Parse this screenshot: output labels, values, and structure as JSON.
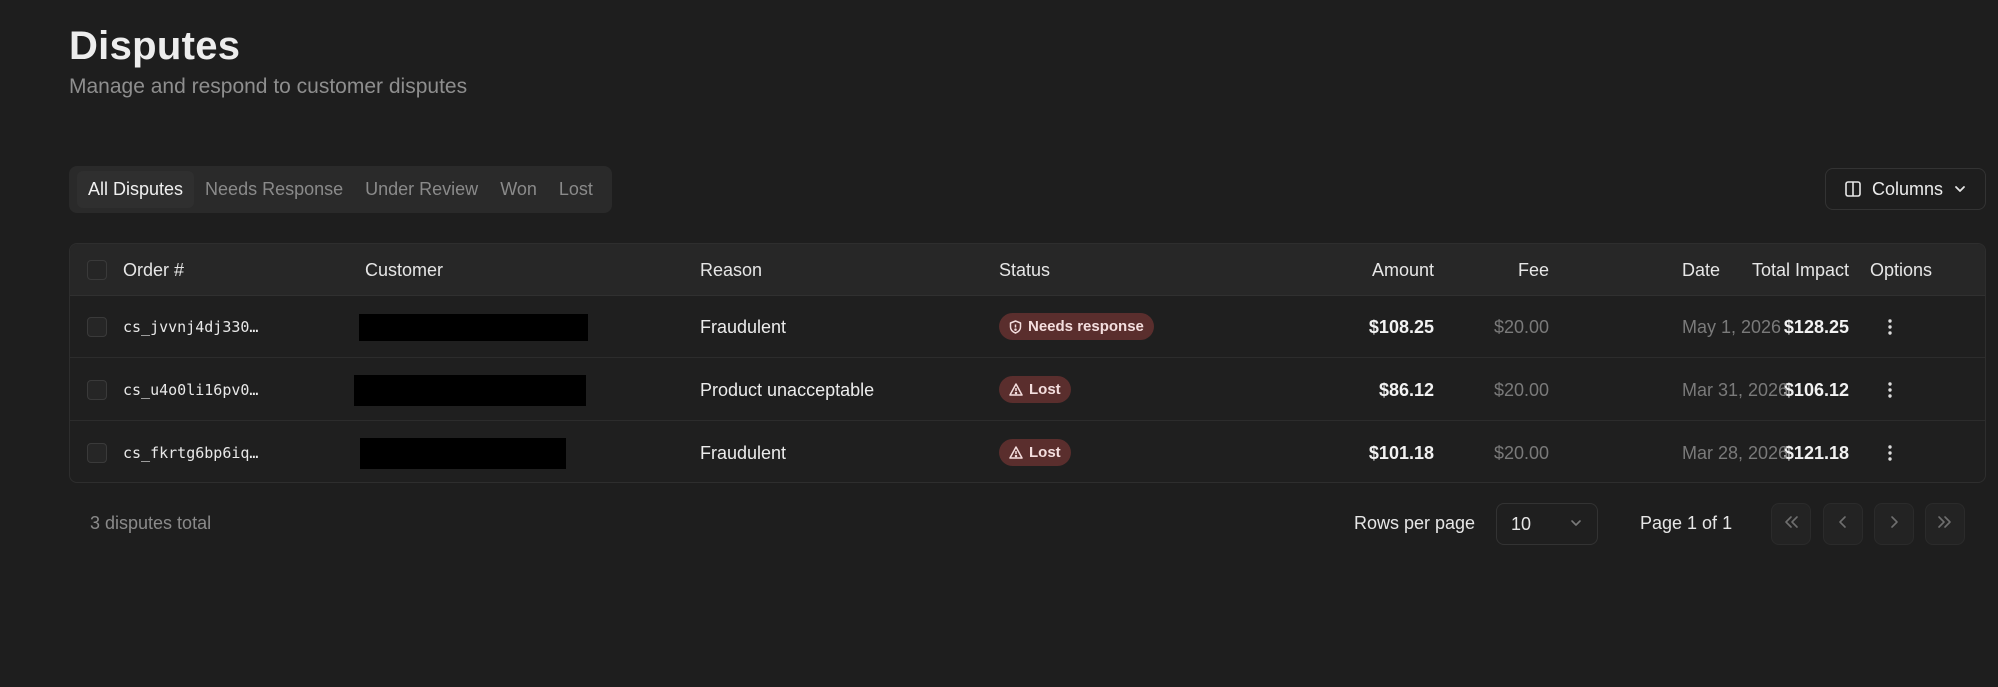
{
  "header": {
    "title": "Disputes",
    "subtitle": "Manage and respond to customer disputes"
  },
  "tabs": [
    {
      "label": "All Disputes",
      "active": true
    },
    {
      "label": "Needs Response",
      "active": false
    },
    {
      "label": "Under Review",
      "active": false
    },
    {
      "label": "Won",
      "active": false
    },
    {
      "label": "Lost",
      "active": false
    }
  ],
  "columns_button": {
    "label": "Columns",
    "icon": "columns-icon",
    "chevron": "chevron-down-icon"
  },
  "table": {
    "headers": {
      "order": "Order #",
      "customer": "Customer",
      "reason": "Reason",
      "status": "Status",
      "amount": "Amount",
      "fee": "Fee",
      "total_impact": "Total Impact",
      "date": "Date",
      "options": "Options"
    },
    "rows": [
      {
        "order": "cs_jvvnj4dj330…",
        "customer": "",
        "reason": "Fraudulent",
        "status": "Needs response",
        "status_icon": "shield-icon",
        "amount": "$108.25",
        "fee": "$20.00",
        "total_impact": "$128.25",
        "date": "May 1, 2026"
      },
      {
        "order": "cs_u4o0li16pv0…",
        "customer": "",
        "reason": "Product unacceptable",
        "status": "Lost",
        "status_icon": "warning-icon",
        "amount": "$86.12",
        "fee": "$20.00",
        "total_impact": "$106.12",
        "date": "Mar 31, 2026"
      },
      {
        "order": "cs_fkrtg6bp6iq…",
        "customer": "",
        "reason": "Fraudulent",
        "status": "Lost",
        "status_icon": "warning-icon",
        "amount": "$101.18",
        "fee": "$20.00",
        "total_impact": "$121.18",
        "date": "Mar 28, 2026"
      }
    ]
  },
  "footer": {
    "total": "3 disputes total",
    "rows_per_page_label": "Rows per page",
    "rows_per_page_value": "10",
    "page_info": "Page 1 of 1"
  },
  "colors": {
    "background": "#1e1e1e",
    "badge_bg": "#5a2e2d",
    "muted_text": "#7a7a7a"
  }
}
